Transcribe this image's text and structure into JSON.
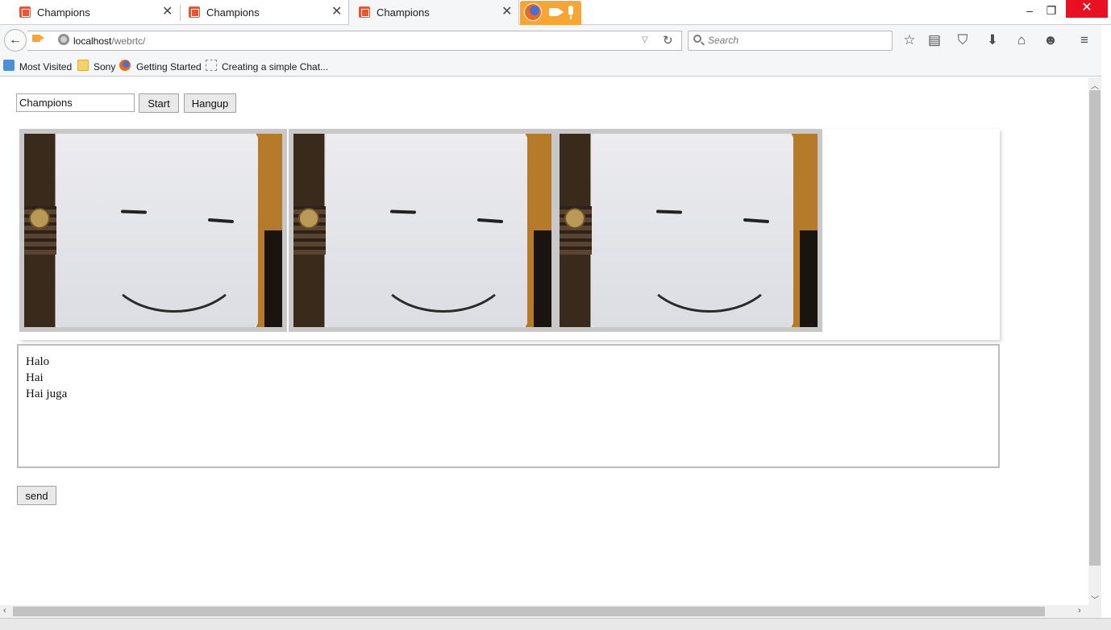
{
  "browser": {
    "tabs": [
      {
        "label": "Champions",
        "active": false
      },
      {
        "label": "Champions",
        "active": false
      },
      {
        "label": "Champions",
        "active": true
      }
    ],
    "url_host": "localhost",
    "url_path": "/webrtc/",
    "search_placeholder": "Search",
    "bookmarks": [
      "Most Visited",
      "Sony",
      "Getting Started",
      "Creating a simple Chat..."
    ],
    "window_controls": {
      "minimize": "–",
      "restore": "❐",
      "close": "✕"
    },
    "media_indicator": [
      "firefox-logo",
      "camera-icon",
      "microphone-icon"
    ]
  },
  "page": {
    "room_input_value": "Champions",
    "start_label": "Start",
    "hangup_label": "Hangup",
    "video_count": 3,
    "chat_lines": [
      "Halo",
      "Hai",
      "Hai juga"
    ],
    "send_label": "send"
  },
  "colors": {
    "accent_orange": "#f7a535",
    "close_red": "#e81123",
    "favicon": "#e8552f"
  }
}
